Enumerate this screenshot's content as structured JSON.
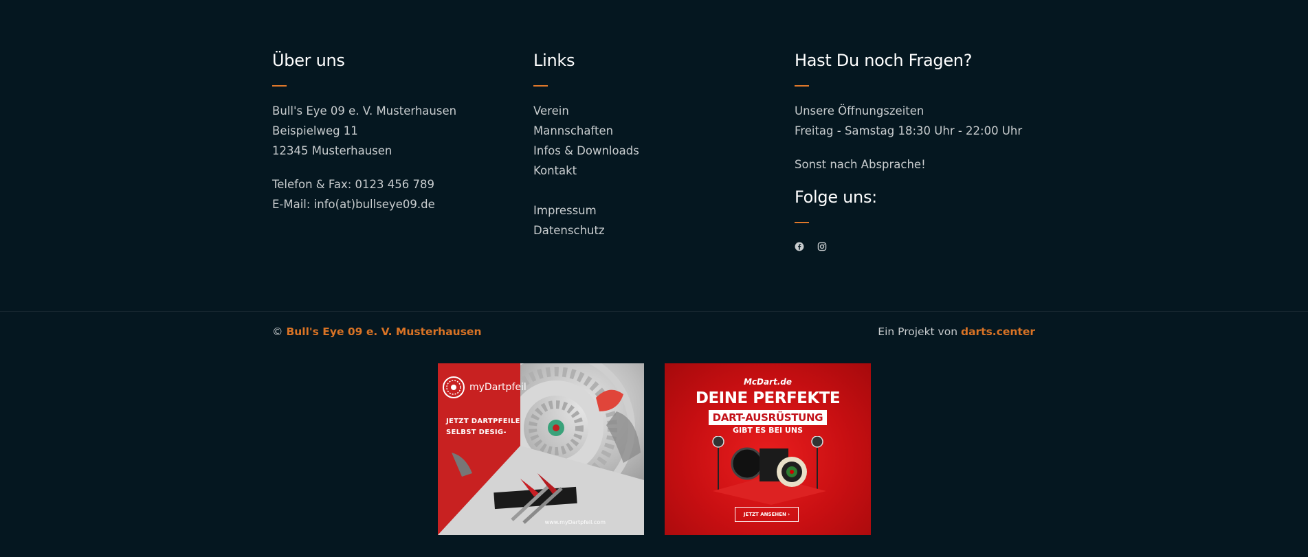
{
  "about": {
    "title": "Über uns",
    "lines": [
      "Bull's Eye 09 e. V. Musterhausen",
      "Beispielweg 11",
      "12345 Musterhausen"
    ],
    "phone": "Telefon & Fax: 0123 456 789",
    "email": "E-Mail: info(at)bullseye09.de"
  },
  "links": {
    "title": "Links",
    "items": [
      "Verein",
      "Mannschaften",
      "Infos & Downloads",
      "Kontakt"
    ],
    "legal": [
      "Impressum",
      "Datenschutz"
    ]
  },
  "contact": {
    "title": "Hast Du noch Fragen?",
    "hours_label": "Unsere Öffnungszeiten",
    "hours": "Freitag - Samstag 18:30 Uhr - 22:00 Uhr",
    "note": "Sonst nach Absprache!",
    "follow_title": "Folge uns:",
    "social_icons": [
      "facebook-icon",
      "instagram-icon"
    ]
  },
  "bottom": {
    "copyright_symbol": "©",
    "club_name": "Bull's Eye 09 e. V. Musterhausen",
    "credit_prefix": "Ein Projekt von",
    "credit_link": "darts.center"
  },
  "ads": {
    "left": {
      "brand": "myDartpfeil",
      "tagline_1": "JETZT DARTPFEILE",
      "tagline_2": "SELBST DESIG-",
      "url": "www.myDartpfeil.com"
    },
    "right": {
      "logo": "McDart.de",
      "headline": "DEINE PERFEKTE",
      "subhead": "DART-AUSRÜSTUNG",
      "small": "GIBT ES BEI UNS",
      "cta": "JETZT ANSEHEN  ›"
    }
  },
  "colors": {
    "background": "#051720",
    "accent": "#d97325",
    "text": "#c8ccce",
    "heading": "#ffffff"
  }
}
